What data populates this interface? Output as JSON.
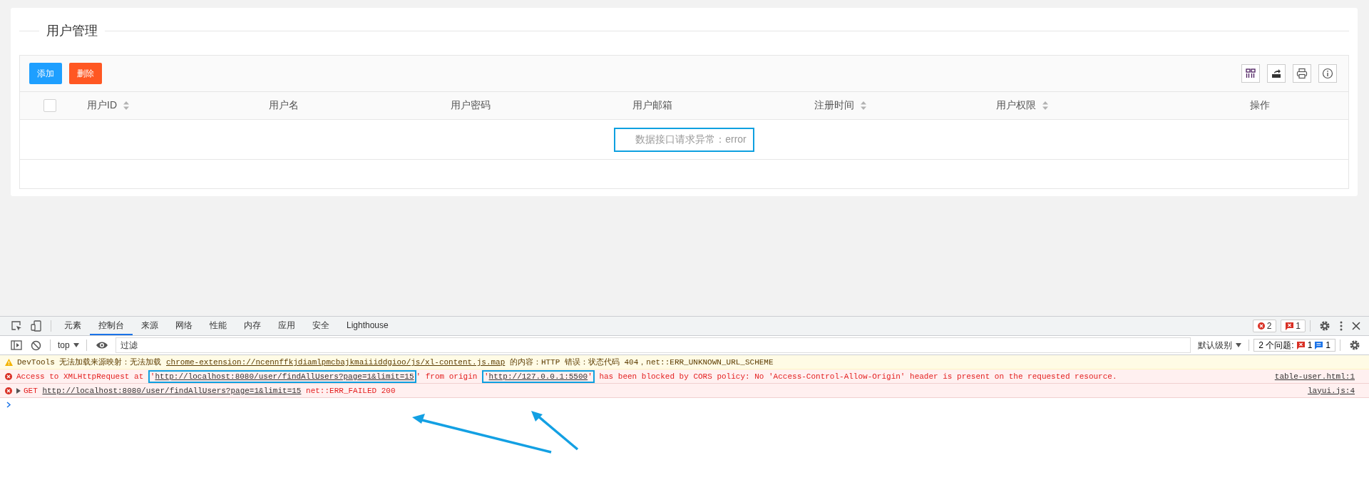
{
  "page": {
    "title": "用户管理"
  },
  "toolbar": {
    "buttons": [
      {
        "label": "添加",
        "kind": "primary"
      },
      {
        "label": "删除",
        "kind": "danger"
      }
    ],
    "tools": [
      {
        "kind": "columns"
      },
      {
        "kind": "export"
      },
      {
        "kind": "print"
      },
      {
        "kind": "info"
      }
    ]
  },
  "table": {
    "select_all": {
      "checked": false
    },
    "columns": [
      {
        "label": "用户ID",
        "sortable": true
      },
      {
        "label": "用户名",
        "sortable": false
      },
      {
        "label": "用户密码",
        "sortable": false
      },
      {
        "label": "用户邮箱",
        "sortable": false
      },
      {
        "label": "注册时间",
        "sortable": true
      },
      {
        "label": "用户权限",
        "sortable": true
      },
      {
        "label": "操作",
        "sortable": false
      }
    ],
    "empty_message": {
      "text": "数据接口请求异常：error",
      "highlighted": true
    }
  },
  "devtools": {
    "tabs": [
      {
        "label": "元素",
        "selected": false
      },
      {
        "label": "控制台",
        "selected": true
      },
      {
        "label": "来源",
        "selected": false
      },
      {
        "label": "网络",
        "selected": false
      },
      {
        "label": "性能",
        "selected": false
      },
      {
        "label": "内存",
        "selected": false
      },
      {
        "label": "应用",
        "selected": false
      },
      {
        "label": "安全",
        "selected": false
      },
      {
        "label": "Lighthouse",
        "selected": false
      }
    ],
    "error_count": "2",
    "issue_count": "1",
    "context": "top",
    "filter": {
      "placeholder": "过滤"
    },
    "level": "默认级别",
    "issues": {
      "label": "2 个问题:",
      "error_count": "1",
      "info_count": "1"
    },
    "messages": [
      {
        "kind": "warning",
        "parts": [
          {
            "kind": "text",
            "text": "DevTools 无法加载来源映射：无法加载 "
          },
          {
            "kind": "link",
            "text": "chrome-extension://ncennffkjdiamlpmcbajkmaiiiddgioo/js/xl-content.js.map"
          },
          {
            "kind": "text",
            "text": " 的内容：HTTP 错误：状态代码 404，net::ERR_UNKNOWN_URL_SCHEME"
          }
        ]
      },
      {
        "kind": "error",
        "source": "table-user.html:1",
        "parts": [
          {
            "kind": "text",
            "text": "Access to XMLHttpRequest at "
          },
          {
            "kind": "box",
            "parts": [
              {
                "kind": "text",
                "text": "'"
              },
              {
                "kind": "link",
                "text": "http://localhost:8080/user/findAllUsers?page=1&limit=15"
              }
            ]
          },
          {
            "kind": "text",
            "text": "' from origin "
          },
          {
            "kind": "box",
            "parts": [
              {
                "kind": "text",
                "text": "'"
              },
              {
                "kind": "link",
                "text": "http://127.0.0.1:5500"
              },
              {
                "kind": "text",
                "text": "'"
              }
            ]
          },
          {
            "kind": "text",
            "text": " has been blocked by CORS policy: No 'Access-Control-Allow-Origin' header is present on the requested resource."
          }
        ]
      },
      {
        "kind": "error",
        "expanded": false,
        "source": "layui.js:4",
        "parts": [
          {
            "kind": "text",
            "text": "GET "
          },
          {
            "kind": "link",
            "text": "http://localhost:8080/user/findAllUsers?page=1&limit=15"
          },
          {
            "kind": "text",
            "text": " net::ERR_FAILED 200"
          }
        ]
      }
    ]
  }
}
